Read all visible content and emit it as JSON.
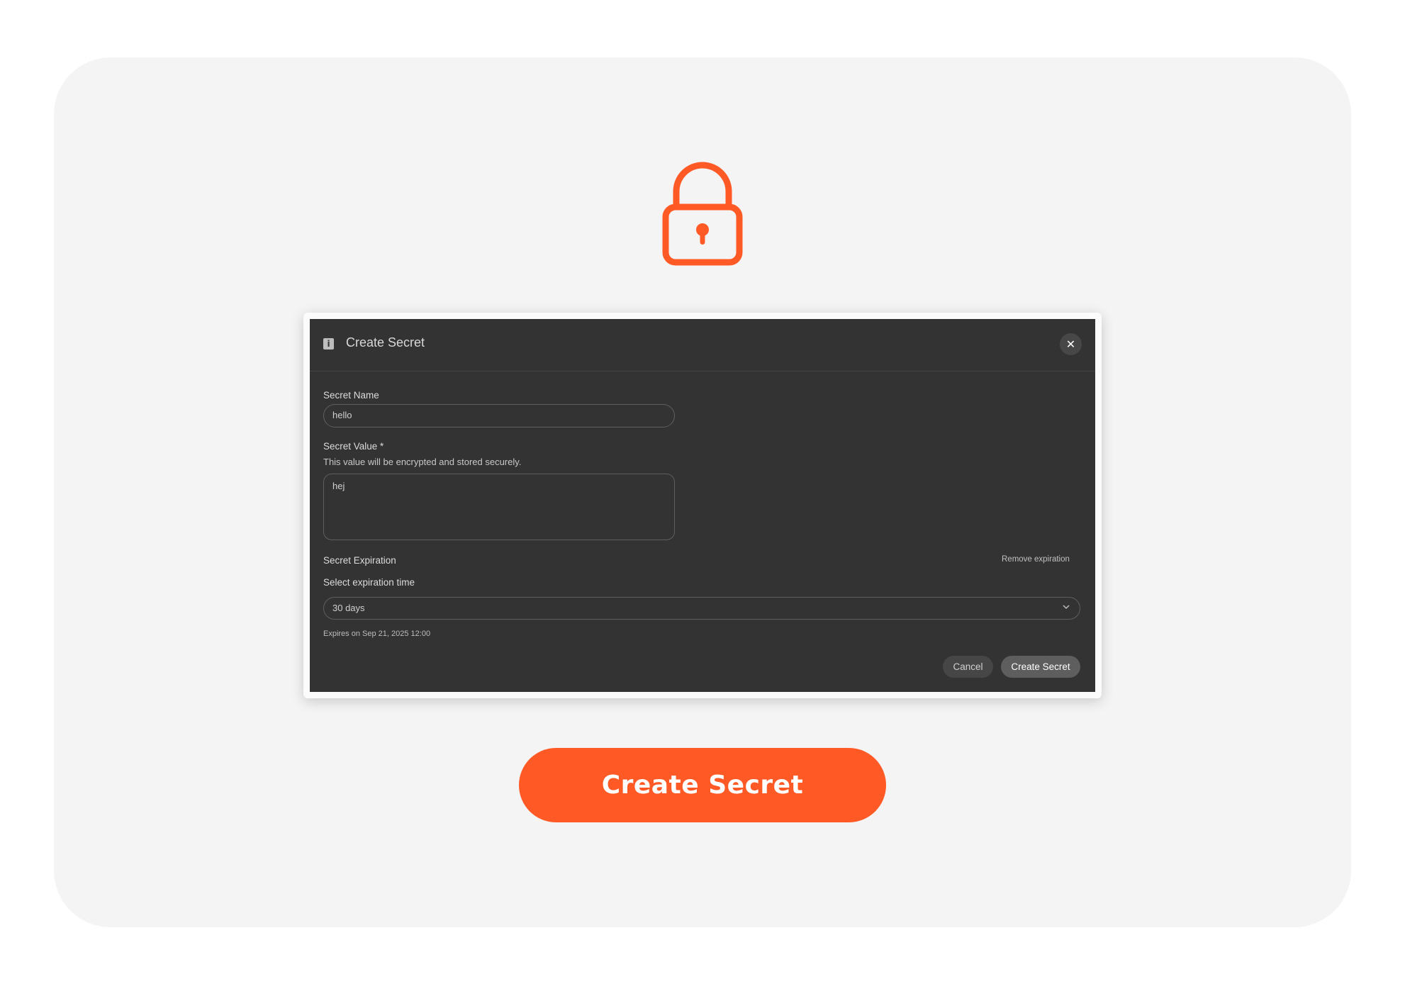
{
  "colors": {
    "accent": "#ff5a26",
    "card_bg": "#f4f4f4",
    "dialog_bg": "#333333"
  },
  "hero": {
    "icon": "lock-icon"
  },
  "dialog": {
    "header_icon": "info-icon",
    "title": "Create Secret",
    "close_icon": "close-icon",
    "close_glyph": "✕",
    "secret_name": {
      "label": "Secret Name",
      "value": "hello"
    },
    "secret_value": {
      "label": "Secret Value *",
      "help": "This value will be encrypted and stored securely.",
      "value": "hej"
    },
    "expiration": {
      "label": "Secret Expiration",
      "remove_link": "Remove expiration",
      "select_label": "Select expiration time",
      "selected": "30 days",
      "expires_note": "Expires on Sep 21, 2025 12:00"
    },
    "buttons": {
      "cancel": "Cancel",
      "create": "Create Secret"
    }
  },
  "cta": {
    "label": "Create Secret"
  }
}
